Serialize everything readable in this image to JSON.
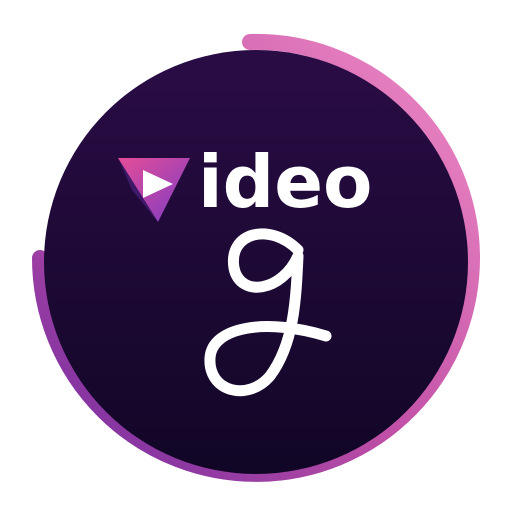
{
  "logo": {
    "wordmark": "ideo",
    "letter": "g",
    "colors": {
      "disc_top": "#2a0c45",
      "disc_bottom": "#110626",
      "ring_pink": "#e879b8",
      "ring_purple": "#7a2fa8",
      "play_pink": "#e64d98",
      "play_purple": "#7b3cc4",
      "text": "#ffffff"
    }
  }
}
